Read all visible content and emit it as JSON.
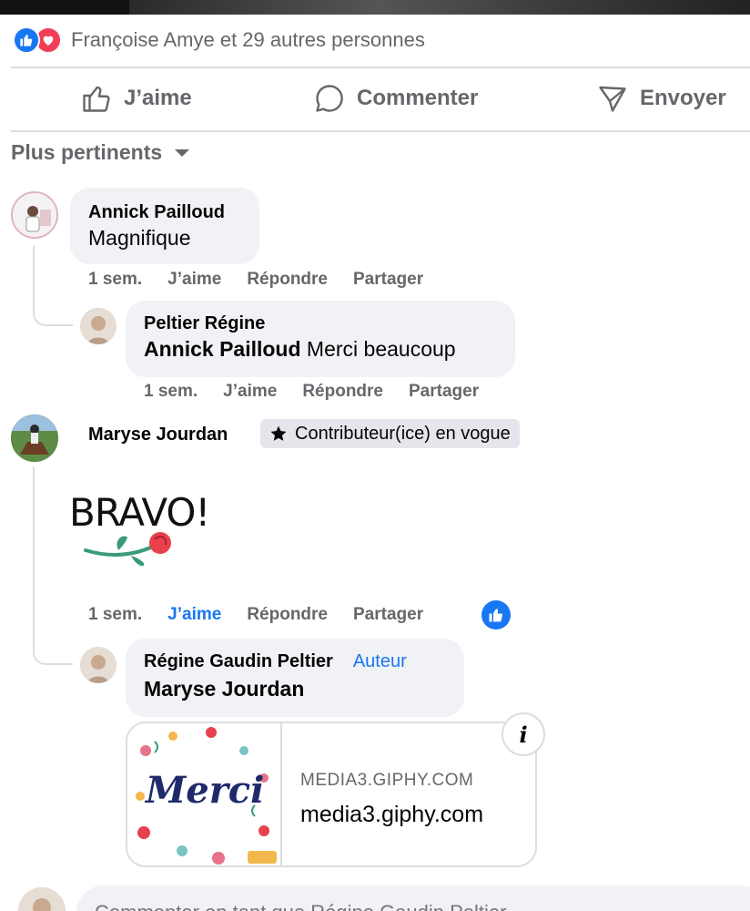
{
  "reactions": {
    "summary": "Françoise Amye et 29 autres personnes",
    "types": [
      "like-icon",
      "love-icon"
    ],
    "like_color": "#1877f2",
    "love_color": "#f33e58"
  },
  "actions": {
    "like": "J’aime",
    "comment": "Commenter",
    "send": "Envoyer"
  },
  "sort": {
    "label": "Plus pertinents"
  },
  "comments": [
    {
      "author": "Annick Pailloud",
      "text": "Magnifique",
      "time": "1 sem.",
      "like": "J’aime",
      "reply": "Répondre",
      "share": "Partager",
      "replies": [
        {
          "author": "Peltier Régine",
          "mention": "Annick Pailloud",
          "text": "Merci beaucoup",
          "time": "1 sem.",
          "like": "J’aime",
          "reply": "Répondre",
          "share": "Partager"
        }
      ]
    },
    {
      "author": "Maryse Jourdan",
      "badge": "Contributeur(ice) en vogue",
      "sticker_text": "BRAVO!",
      "time": "1 sem.",
      "like": "J’aime",
      "reply": "Répondre",
      "share": "Partager",
      "liked": true,
      "replies": [
        {
          "author": "Régine Gaudin Peltier",
          "author_tag": "Auteur",
          "mention": "Maryse Jourdan",
          "link": {
            "domain": "MEDIA3.GIPHY.COM",
            "title": "media3.giphy.com",
            "thumb_text": "Merci"
          }
        }
      ]
    }
  ],
  "composer": {
    "placeholder": "Commenter en tant que Régine Gaudin Peltier"
  }
}
